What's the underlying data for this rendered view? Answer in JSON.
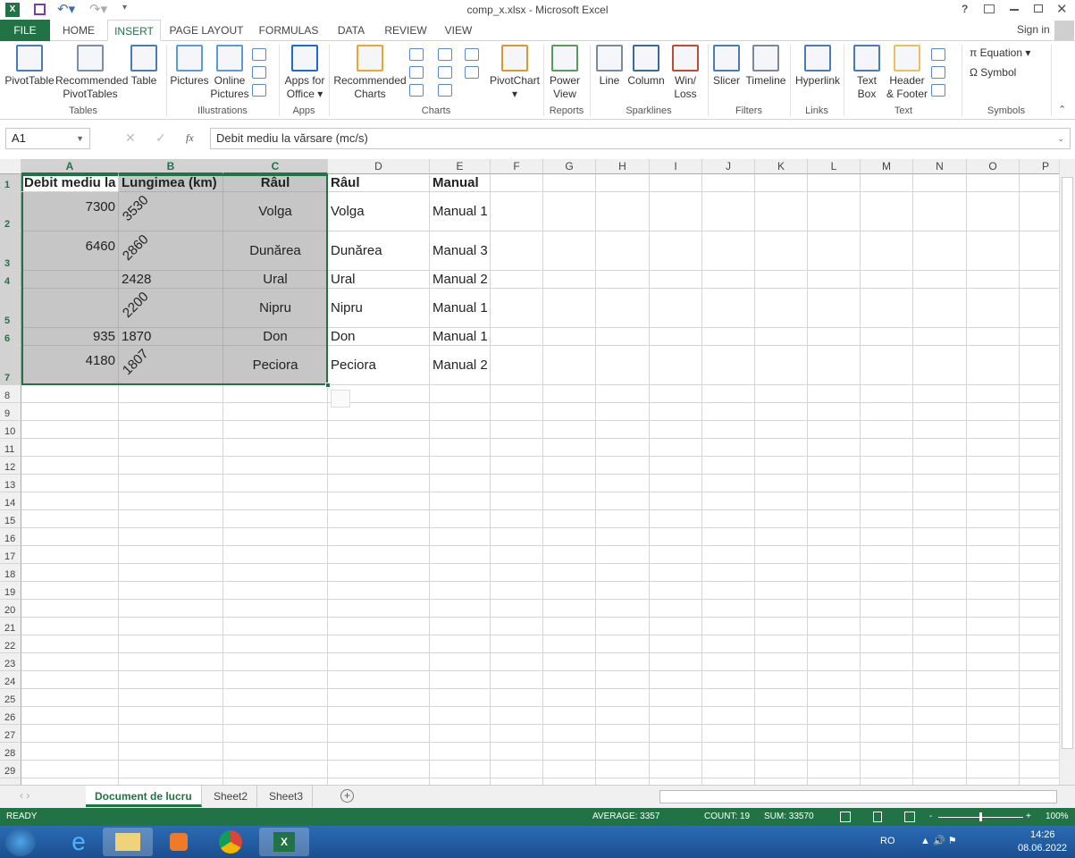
{
  "window": {
    "title": "comp_x.xlsx - Microsoft Excel",
    "help": "?",
    "sign_in": "Sign in"
  },
  "ribbon_tabs": [
    "FILE",
    "HOME",
    "INSERT",
    "PAGE LAYOUT",
    "FORMULAS",
    "DATA",
    "REVIEW",
    "VIEW"
  ],
  "active_tab": "INSERT",
  "ribbon": {
    "buttons": [
      {
        "label": "PivotTable",
        "icon": "pivottable-icon"
      },
      {
        "label": "Recommended PivotTables",
        "icon": "recommended-pivottables-icon"
      },
      {
        "label": "Table",
        "icon": "table-icon"
      },
      {
        "label": "Pictures",
        "icon": "pictures-icon"
      },
      {
        "label": "Online Pictures",
        "icon": "online-pictures-icon"
      },
      {
        "label": "Apps for Office ▾",
        "icon": "apps-for-office-icon"
      },
      {
        "label": "Recommended Charts",
        "icon": "recommended-charts-icon"
      },
      {
        "label": "PivotChart ▾",
        "icon": "pivotchart-icon"
      },
      {
        "label": "Power View",
        "icon": "power-view-icon"
      },
      {
        "label": "Line",
        "icon": "sparkline-line-icon"
      },
      {
        "label": "Column",
        "icon": "sparkline-column-icon"
      },
      {
        "label": "Win/ Loss",
        "icon": "sparkline-winloss-icon"
      },
      {
        "label": "Slicer",
        "icon": "slicer-icon"
      },
      {
        "label": "Timeline",
        "icon": "timeline-icon"
      },
      {
        "label": "Hyperlink",
        "icon": "hyperlink-icon"
      },
      {
        "label": "Text Box",
        "icon": "text-box-icon"
      },
      {
        "label": "Header & Footer",
        "icon": "header-footer-icon"
      }
    ],
    "equation": "π Equation",
    "symbol": "Ω Symbol",
    "groups": [
      "Tables",
      "Illustrations",
      "Apps",
      "Charts",
      "Reports",
      "Sparklines",
      "Filters",
      "Links",
      "Text",
      "Symbols"
    ]
  },
  "formula_bar": {
    "name_box": "A1",
    "fx": "fx",
    "cancel": "✕",
    "enter": "✓",
    "content": "Debit mediu la vărsare (mc/s)"
  },
  "columns": [
    "A",
    "B",
    "C",
    "D",
    "E",
    "F",
    "G",
    "H",
    "I",
    "J",
    "K",
    "L",
    "M",
    "N",
    "O",
    "P"
  ],
  "rows": [
    [
      "Debit mediu la",
      "Lungimea (km)",
      "Râul",
      "Râul",
      "Manual"
    ],
    [
      "7300",
      "3530",
      "Volga",
      "Volga",
      "Manual 1"
    ],
    [
      "6460",
      "2860",
      "Dunărea",
      "Dunărea",
      "Manual 3"
    ],
    [
      "",
      "2428",
      "Ural",
      "Ural",
      "Manual 2"
    ],
    [
      "",
      "2200",
      "Nipru",
      "Nipru",
      "Manual 1"
    ],
    [
      "935",
      "1870",
      "Don",
      "Don",
      "Manual 1"
    ],
    [
      "4180",
      "1807",
      "Peciora",
      "Peciora",
      "Manual 2"
    ]
  ],
  "sheets": [
    "Document de lucru",
    "Sheet2",
    "Sheet3"
  ],
  "active_sheet": "Document de lucru",
  "status": {
    "mode": "READY",
    "average": "AVERAGE: 3357",
    "count": "COUNT: 19",
    "sum": "SUM: 33570",
    "zoom": "100%"
  },
  "taskbar": {
    "lang": "RO",
    "time": "14:26",
    "date": "08.06.2022"
  },
  "colors": {
    "accent": "#217346",
    "selection": "#c6c6c6",
    "taskbar": "#1f5ba0"
  }
}
